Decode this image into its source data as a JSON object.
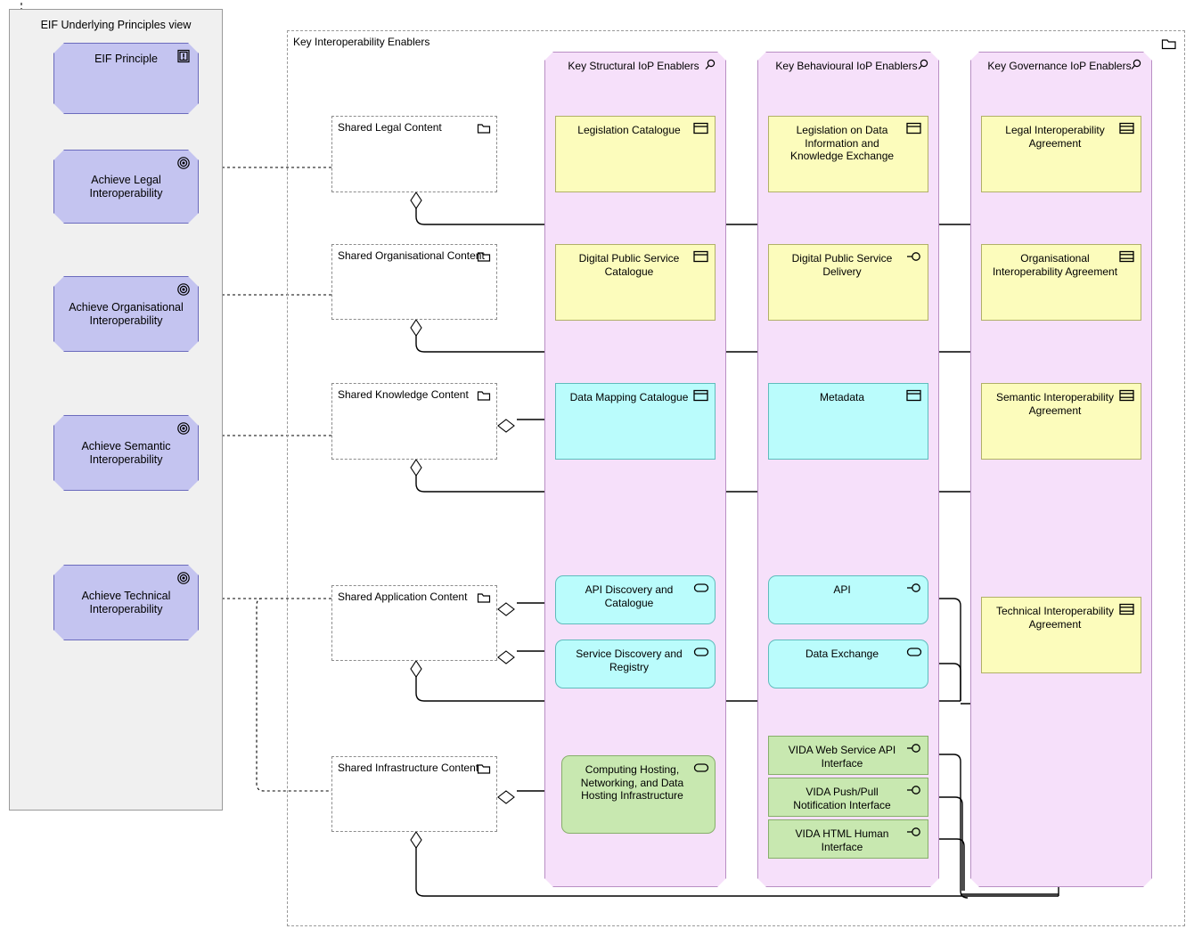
{
  "view": {
    "title": "EIF Underlying Principles view",
    "principles": [
      {
        "label": "EIF Principle",
        "icon": "principle-icon"
      },
      {
        "label": "Achieve Legal Interoperability",
        "icon": "goal-icon"
      },
      {
        "label": "Achieve Organisational Interoperability",
        "icon": "goal-icon"
      },
      {
        "label": "Achieve Semantic Interoperability",
        "icon": "goal-icon"
      },
      {
        "label": "Achieve Technical Interoperability",
        "icon": "goal-icon"
      }
    ]
  },
  "enablers": {
    "title": "Key Interoperability Enablers",
    "icon": "folder-icon",
    "columns": [
      {
        "title": "Key Structural IoP Enablers",
        "icon": "grouping-magnifier-icon"
      },
      {
        "title": "Key Behavioural IoP Enablers",
        "icon": "grouping-magnifier-icon"
      },
      {
        "title": "Key Governance IoP Enablers",
        "icon": "grouping-magnifier-icon"
      }
    ]
  },
  "shared_content": [
    {
      "label": "Shared Legal Content",
      "icon": "folder-icon"
    },
    {
      "label": "Shared Organisational Content",
      "icon": "folder-icon"
    },
    {
      "label": "Shared Knowledge Content",
      "icon": "folder-icon"
    },
    {
      "label": "Shared Application Content",
      "icon": "folder-icon"
    },
    {
      "label": "Shared Infrastructure Content",
      "icon": "folder-icon"
    }
  ],
  "elements": {
    "legislation_catalogue": {
      "label": "Legislation Catalogue",
      "icon": "business-object-icon",
      "color": "#fcfcbc"
    },
    "legislation_on_data": {
      "label": "Legislation on Data Information and Knowledge Exchange",
      "icon": "business-object-icon",
      "color": "#fcfcbc"
    },
    "legal_agreement": {
      "label": "Legal Interoperability Agreement",
      "icon": "contract-icon",
      "color": "#fcfcbc"
    },
    "dps_catalogue": {
      "label": "Digital Public Service Catalogue",
      "icon": "business-object-icon",
      "color": "#fcfcbc"
    },
    "dps_delivery": {
      "label": "Digital Public Service Delivery",
      "icon": "interface-icon",
      "color": "#fcfcbc"
    },
    "org_agreement": {
      "label": "Organisational Interoperability Agreement",
      "icon": "contract-icon",
      "color": "#fcfcbc"
    },
    "data_mapping_catalogue": {
      "label": "Data Mapping Catalogue",
      "icon": "business-object-icon",
      "color": "#bafcfc"
    },
    "metadata": {
      "label": "Metadata",
      "icon": "business-object-icon",
      "color": "#bafcfc"
    },
    "semantic_agreement": {
      "label": "Semantic Interoperability Agreement",
      "icon": "contract-icon",
      "color": "#fcfcbc"
    },
    "api_discovery": {
      "label": "API Discovery and Catalogue",
      "icon": "application-service-icon",
      "color": "#bafcfc"
    },
    "service_discovery": {
      "label": "Service Discovery and Registry",
      "icon": "application-service-icon",
      "color": "#bafcfc"
    },
    "api": {
      "label": "API",
      "icon": "interface-icon",
      "color": "#bafcfc"
    },
    "data_exchange": {
      "label": "Data Exchange",
      "icon": "application-service-icon",
      "color": "#bafcfc"
    },
    "technical_agreement": {
      "label": "Technical Interoperability Agreement",
      "icon": "contract-icon",
      "color": "#fcfcbc"
    },
    "computing_hosting": {
      "label": "Computing Hosting, Networking, and Data Hosting Infrastructure",
      "icon": "technology-service-icon",
      "color": "#c8e8b0"
    },
    "vida_web_service": {
      "label": "VIDA Web Service API Interface",
      "icon": "interface-icon",
      "color": "#c8e8b0"
    },
    "vida_push_pull": {
      "label": "VIDA Push/Pull Notification Interface",
      "icon": "interface-icon",
      "color": "#c8e8b0"
    },
    "vida_html": {
      "label": "VIDA HTML Human Interface",
      "icon": "interface-icon",
      "color": "#c8e8b0"
    }
  },
  "colors": {
    "motivation": "#c4c4f0",
    "grouping": "#f6e0fa",
    "business": "#fcfcbc",
    "application": "#bafcfc",
    "technology": "#c8e8b0",
    "view_background": "#f0f0f0"
  }
}
